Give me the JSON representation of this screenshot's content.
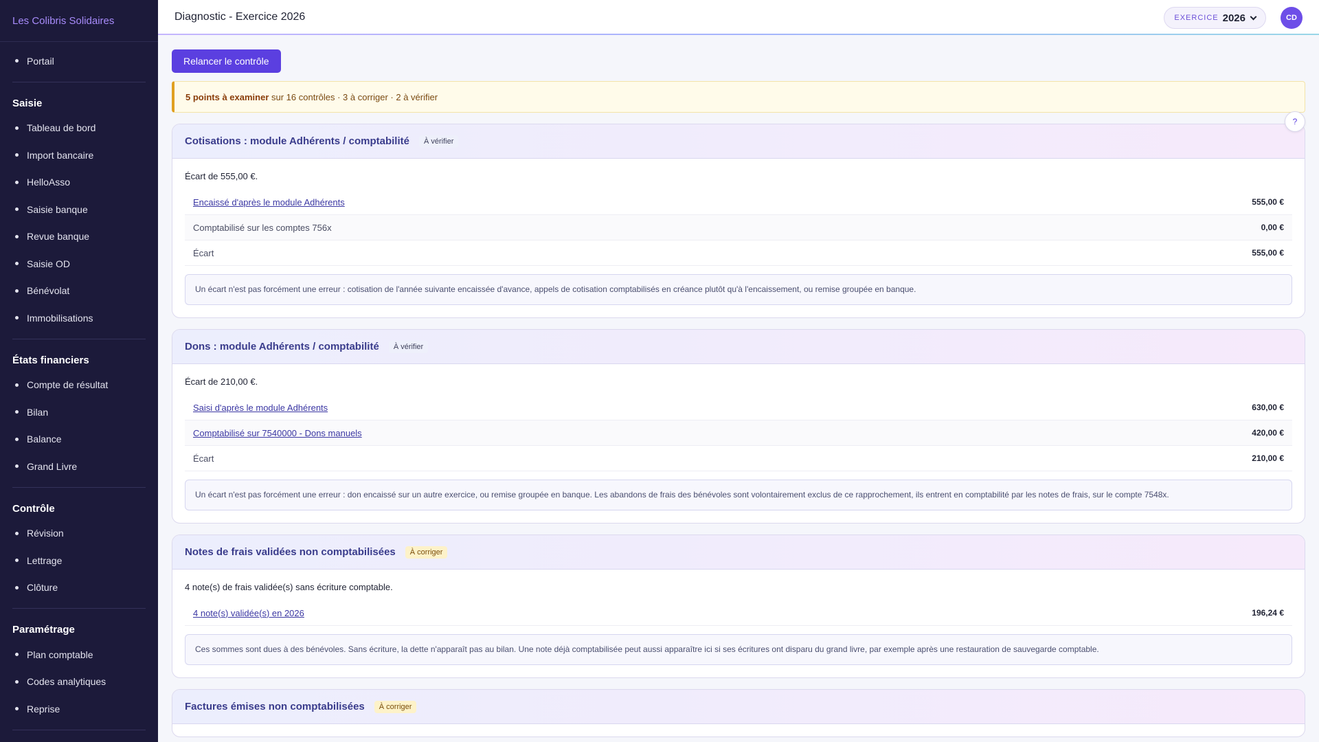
{
  "brand": "Les Colibris Solidaires",
  "sidebar": {
    "portal": {
      "label": "Portail"
    },
    "sections": [
      {
        "title": "Saisie",
        "items": [
          "Tableau de bord",
          "Import bancaire",
          "HelloAsso",
          "Saisie banque",
          "Revue banque",
          "Saisie OD",
          "Bénévolat",
          "Immobilisations"
        ]
      },
      {
        "title": "États financiers",
        "items": [
          "Compte de résultat",
          "Bilan",
          "Balance",
          "Grand Livre"
        ]
      },
      {
        "title": "Contrôle",
        "items": [
          "Révision",
          "Lettrage",
          "Clôture"
        ]
      },
      {
        "title": "Paramétrage",
        "items": [
          "Plan comptable",
          "Codes analytiques",
          "Reprise"
        ]
      }
    ]
  },
  "header": {
    "title": "Diagnostic - Exercice 2026",
    "exercise_label": "EXERCICE",
    "exercise_year": "2026",
    "avatar_initials": "CD"
  },
  "main": {
    "rerun_label": "Relancer le contrôle",
    "summary": {
      "strong": "5 points à examiner",
      "rest": " sur 16 contrôles · 3 à corriger · 2 à vérifier"
    },
    "help_label": "?",
    "cards": [
      {
        "title": "Cotisations : module Adhérents / comptabilité",
        "badge": "À vérifier",
        "badge_type": "check",
        "summary": "Écart de 555,00 €.",
        "rows": [
          {
            "label": "Encaissé d'après le module Adhérents",
            "amount": "555,00 €",
            "link": true
          },
          {
            "label": "Comptabilisé sur les comptes 756x",
            "amount": "0,00 €",
            "link": false
          },
          {
            "label": "Écart",
            "amount": "555,00 €",
            "link": false
          }
        ],
        "note": "Un écart n'est pas forcément une erreur : cotisation de l'année suivante encaissée d'avance, appels de cotisation comptabilisés en créance plutôt qu'à l'encaissement, ou remise groupée en banque."
      },
      {
        "title": "Dons : module Adhérents / comptabilité",
        "badge": "À vérifier",
        "badge_type": "check",
        "summary": "Écart de 210,00 €.",
        "rows": [
          {
            "label": "Saisi d'après le module Adhérents",
            "amount": "630,00 €",
            "link": true
          },
          {
            "label": "Comptabilisé sur 7540000 - Dons manuels",
            "amount": "420,00 €",
            "link": true
          },
          {
            "label": "Écart",
            "amount": "210,00 €",
            "link": false
          }
        ],
        "note": "Un écart n'est pas forcément une erreur : don encaissé sur un autre exercice, ou remise groupée en banque. Les abandons de frais des bénévoles sont volontairement exclus de ce rapprochement, ils entrent en comptabilité par les notes de frais, sur le compte 7548x."
      },
      {
        "title": "Notes de frais validées non comptabilisées",
        "badge": "À corriger",
        "badge_type": "fix",
        "summary": "4 note(s) de frais validée(s) sans écriture comptable.",
        "rows": [
          {
            "label": "4 note(s) validée(s) en 2026",
            "amount": "196,24 €",
            "link": true
          }
        ],
        "note": "Ces sommes sont dues à des bénévoles. Sans écriture, la dette n'apparaît pas au bilan. Une note déjà comptabilisée peut aussi apparaître ici si ses écritures ont disparu du grand livre, par exemple après une restauration de sauvegarde comptable."
      },
      {
        "title": "Factures émises non comptabilisées",
        "badge": "À corriger",
        "badge_type": "fix"
      }
    ]
  }
}
